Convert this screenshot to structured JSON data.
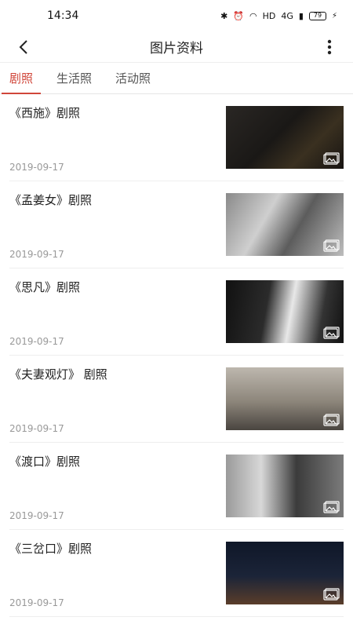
{
  "status_bar": {
    "time": "14:34",
    "network": "HD",
    "signal": "4G",
    "battery": "79"
  },
  "app_bar": {
    "title": "图片资料"
  },
  "tabs": [
    {
      "label": "剧照",
      "active": true
    },
    {
      "label": "生活照",
      "active": false
    },
    {
      "label": "活动照",
      "active": false
    }
  ],
  "items": [
    {
      "title": "《西施》剧照",
      "date": "2019-09-17"
    },
    {
      "title": "《孟姜女》剧照",
      "date": "2019-09-17"
    },
    {
      "title": "《思凡》剧照",
      "date": "2019-09-17"
    },
    {
      "title": "《夫妻观灯》 剧照",
      "date": "2019-09-17"
    },
    {
      "title": "《渡口》剧照",
      "date": "2019-09-17"
    },
    {
      "title": "《三岔口》剧照",
      "date": "2019-09-17"
    }
  ],
  "icons": {
    "back": "chevron-left-icon",
    "more": "more-vertical-icon",
    "gallery": "image-gallery-icon"
  },
  "colors": {
    "accent": "#d0463a"
  }
}
